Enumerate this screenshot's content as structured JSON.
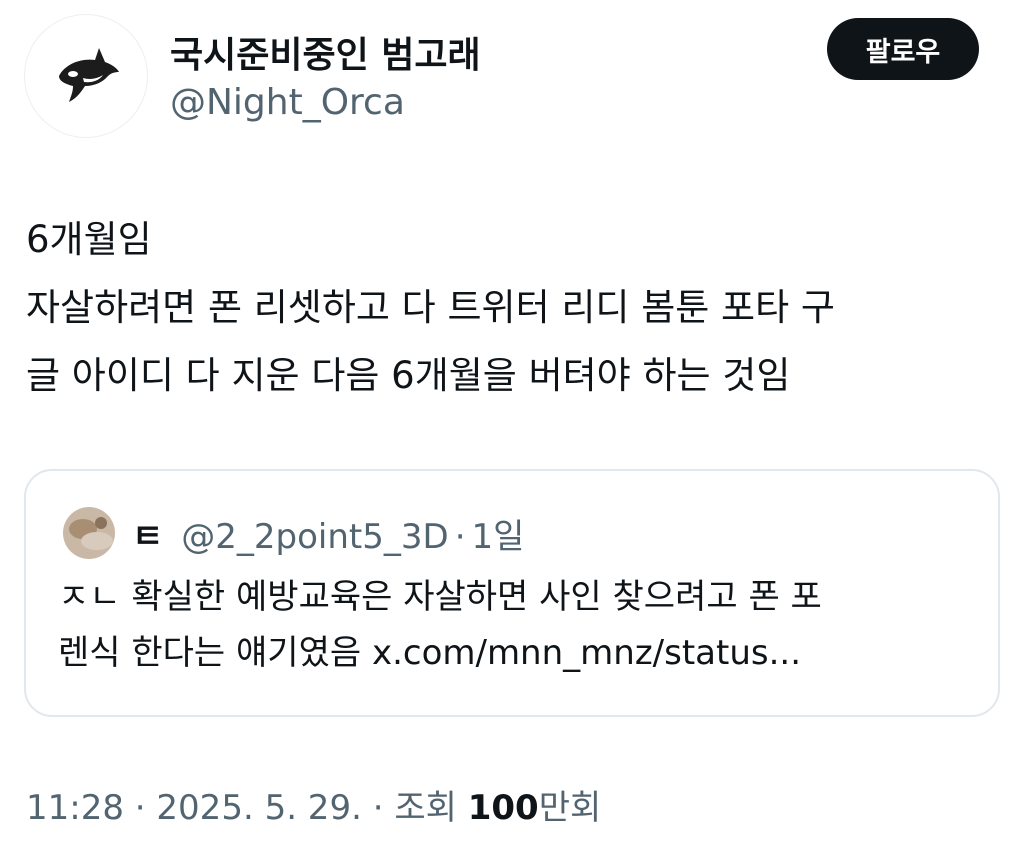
{
  "author": {
    "display_name": "국시준비중인 범고래",
    "handle": "@Night_Orca",
    "avatar_icon": "orca-icon"
  },
  "follow_button": {
    "label": "팔로우"
  },
  "tweet": {
    "lines": [
      "6개월임",
      "자살하려면 폰 리셋하고 다 트위터 리디 봄툰 포타 구",
      "글 아이디 다 지운 다음 6개월을 버텨야 하는 것임"
    ]
  },
  "quote": {
    "name": "ㅌ",
    "handle": "@2_2point5_3D",
    "separator": "·",
    "time": "1일",
    "lines": [
      "ㅈㄴ 확실한 예방교육은 자살하면 사인 찾으려고 폰 포",
      "렌식 한다는 얘기였음 x.com/mnn_mnz/status..."
    ]
  },
  "meta": {
    "time": "11:28",
    "dot1": "·",
    "date": "2025. 5. 29.",
    "dot2": "·",
    "views_label": "조회",
    "views_count": "100",
    "views_unit": "만회"
  },
  "colors": {
    "text": "#0f1419",
    "secondary": "#536471",
    "border": "#e1e8ed",
    "button_bg": "#0f1419"
  }
}
